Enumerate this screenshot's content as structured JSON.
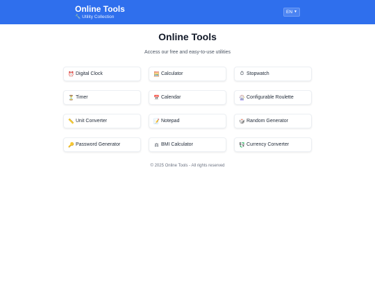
{
  "header": {
    "title": "Online Tools",
    "subtitle_icon": "wrench-icon",
    "subtitle": "Utility Collection",
    "language": "EN",
    "colors": {
      "bar": "#2f6fed"
    }
  },
  "main": {
    "title": "Online Tools",
    "subtitle": "Access our free and easy-to-use utilities"
  },
  "tools": [
    {
      "label": "Digital Clock",
      "icon": "⏰",
      "icon_name": "alarm-clock-icon"
    },
    {
      "label": "Calculator",
      "icon": "🧮",
      "icon_name": "abacus-icon"
    },
    {
      "label": "Stopwatch",
      "icon": "⏱",
      "icon_name": "stopwatch-icon"
    },
    {
      "label": "Timer",
      "icon": "⏳",
      "icon_name": "hourglass-icon"
    },
    {
      "label": "Calendar",
      "icon": "📅",
      "icon_name": "calendar-icon"
    },
    {
      "label": "Configurable Roulette",
      "icon": "🎡",
      "icon_name": "ferris-wheel-icon"
    },
    {
      "label": "Unit Converter",
      "icon": "📏",
      "icon_name": "ruler-icon"
    },
    {
      "label": "Notepad",
      "icon": "📝",
      "icon_name": "memo-icon"
    },
    {
      "label": "Random Generator",
      "icon": "🎲",
      "icon_name": "dice-icon"
    },
    {
      "label": "Password Generator",
      "icon": "🔑",
      "icon_name": "key-icon"
    },
    {
      "label": "BMI Calculator",
      "icon": "⚖",
      "icon_name": "scale-icon"
    },
    {
      "label": "Currency Converter",
      "icon": "💱",
      "icon_name": "currency-exchange-icon"
    }
  ],
  "footer": {
    "text": "© 2025 Online Tools - All rights reserved"
  }
}
